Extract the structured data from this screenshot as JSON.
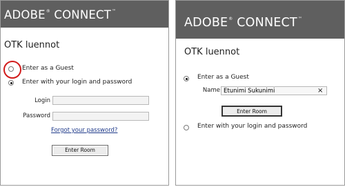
{
  "left_panel": {
    "logo_text": "ADOBE® CONNECT™",
    "meeting_title": "OTK luennot",
    "guest_option_label": "Enter as a Guest",
    "login_option_label": "Enter with your login and password",
    "guest_selected": false,
    "login_selected": true,
    "login_label": "Login",
    "login_value": "",
    "password_label": "Password",
    "password_value": "",
    "forgot_link": "Forgot your password?",
    "enter_button": "Enter Room",
    "highlight_color": "#d11a1a"
  },
  "right_panel": {
    "logo_text": "ADOBE® CONNECT™",
    "meeting_title": "OTK luennot",
    "guest_option_label": "Enter as a Guest",
    "guest_selected": true,
    "name_label": "Name",
    "name_value": "Etunimi Sukunimi",
    "clear_icon": "×",
    "enter_button": "Enter Room",
    "login_option_label": "Enter with your login and password",
    "login_selected": false
  },
  "colors": {
    "header_bg": "#5f5f5f",
    "link": "#1f3a8a"
  }
}
